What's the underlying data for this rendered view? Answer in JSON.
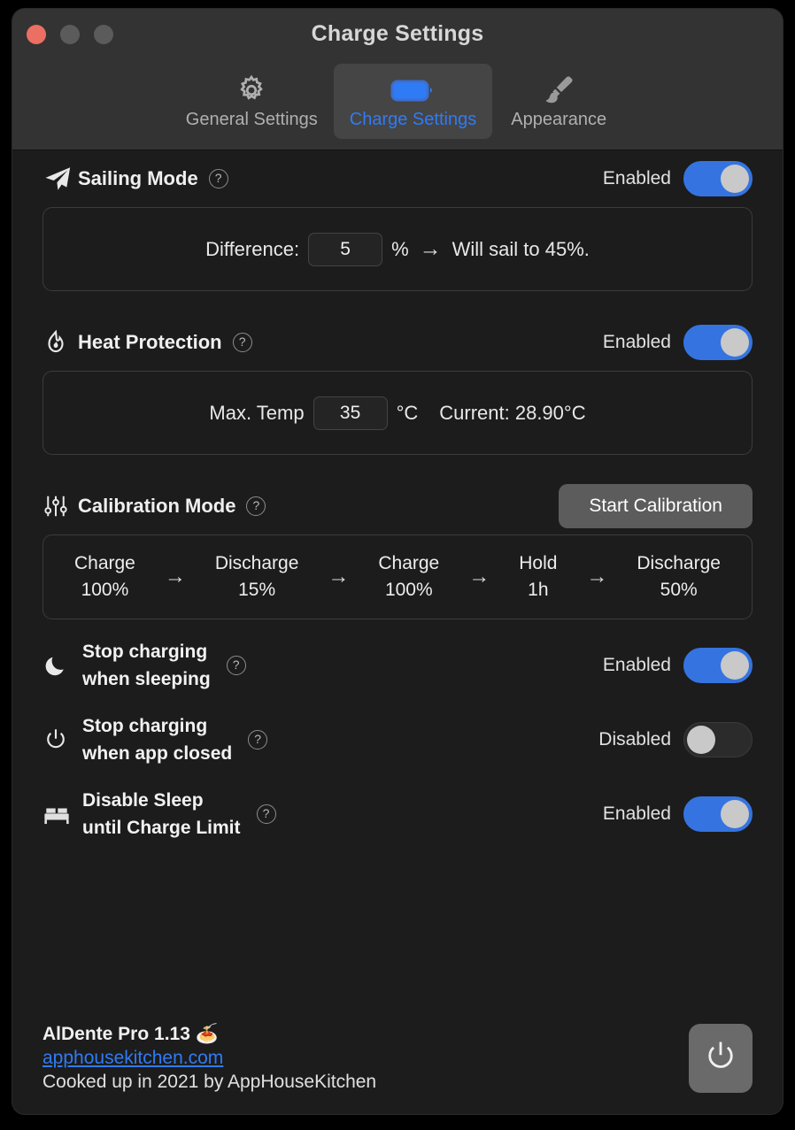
{
  "window": {
    "title": "Charge Settings",
    "traffic_lights": [
      "close",
      "minimize",
      "maximize"
    ]
  },
  "tabs": [
    {
      "label": "General Settings",
      "icon": "gear-icon",
      "active": false
    },
    {
      "label": "Charge Settings",
      "icon": "battery-icon",
      "active": true
    },
    {
      "label": "Appearance",
      "icon": "paintbrush-icon",
      "active": false
    }
  ],
  "sections": {
    "sailing": {
      "icon": "paper-plane-icon",
      "title": "Sailing Mode",
      "help": "?",
      "state_label": "Enabled",
      "enabled": true,
      "panel": {
        "difference_label": "Difference:",
        "difference_value": "5",
        "unit": "%",
        "arrow": "→",
        "result_text": "Will sail to 45%."
      }
    },
    "heat": {
      "icon": "flame-icon",
      "title": "Heat Protection",
      "help": "?",
      "state_label": "Enabled",
      "enabled": true,
      "panel": {
        "max_temp_label": "Max. Temp",
        "max_temp_value": "35",
        "unit": "°C",
        "current_text": "Current: 28.90°C"
      }
    },
    "calibration": {
      "icon": "sliders-icon",
      "title": "Calibration Mode",
      "help": "?",
      "button_label": "Start Calibration",
      "arrow": "→",
      "steps": [
        {
          "name": "Charge",
          "value": "100%"
        },
        {
          "name": "Discharge",
          "value": "15%"
        },
        {
          "name": "Charge",
          "value": "100%"
        },
        {
          "name": "Hold",
          "value": "1h"
        },
        {
          "name": "Discharge",
          "value": "50%"
        }
      ]
    }
  },
  "toggle_rows": [
    {
      "icon": "moon-icon",
      "label_line1": "Stop charging",
      "label_line2": "when sleeping",
      "help": "?",
      "state_label": "Enabled",
      "enabled": true
    },
    {
      "icon": "power-icon",
      "label_line1": "Stop charging",
      "label_line2": "when app closed",
      "help": "?",
      "state_label": "Disabled",
      "enabled": false
    },
    {
      "icon": "bed-icon",
      "label_line1": "Disable Sleep",
      "label_line2": "until Charge Limit",
      "help": "?",
      "state_label": "Enabled",
      "enabled": true
    }
  ],
  "footer": {
    "app_name": "AlDente Pro 1.13 🍝",
    "website": "apphousekitchen.com",
    "credits": "Cooked up in 2021 by AppHouseKitchen",
    "power_button_icon": "power-icon"
  },
  "colors": {
    "accent": "#2f7bf6",
    "toggle_on": "#3574e0",
    "window_bg": "#1c1c1c",
    "titlebar_bg": "#333333",
    "button_grey": "#5c5c5c"
  }
}
